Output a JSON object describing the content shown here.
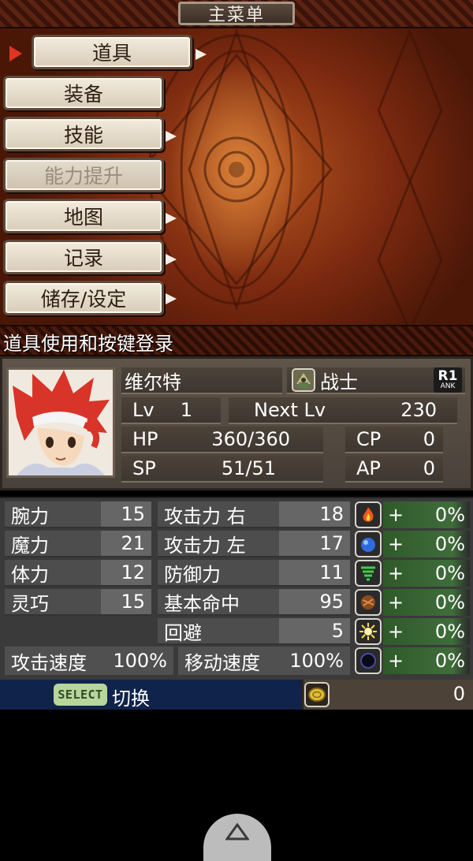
{
  "header": {
    "title": "主菜单"
  },
  "menu": {
    "items": [
      {
        "label": "道具",
        "selected": true,
        "disabled": false,
        "has_submenu": true
      },
      {
        "label": "装备",
        "selected": false,
        "disabled": false,
        "has_submenu": false
      },
      {
        "label": "技能",
        "selected": false,
        "disabled": false,
        "has_submenu": true
      },
      {
        "label": "能力提升",
        "selected": false,
        "disabled": true,
        "has_submenu": false
      },
      {
        "label": "地图",
        "selected": false,
        "disabled": false,
        "has_submenu": true
      },
      {
        "label": "记录",
        "selected": false,
        "disabled": false,
        "has_submenu": true
      },
      {
        "label": "储存/设定",
        "selected": false,
        "disabled": false,
        "has_submenu": true
      }
    ],
    "description": "道具使用和按键登录"
  },
  "character": {
    "name": "维尔特",
    "class": "战士",
    "class_icon": "warrior-icon",
    "rank_badge": {
      "top": "R1",
      "bottom": "ANK"
    },
    "lv_label": "Lv",
    "lv": "1",
    "next_lv_label": "Next Lv",
    "next_lv": "230",
    "hp_label": "HP",
    "hp": "360/360",
    "sp_label": "SP",
    "sp": "51/51",
    "cp_label": "CP",
    "cp": "0",
    "ap_label": "AP",
    "ap": "0"
  },
  "stats": {
    "left": [
      {
        "label": "腕力",
        "value": "15"
      },
      {
        "label": "魔力",
        "value": "21"
      },
      {
        "label": "体力",
        "value": "12"
      },
      {
        "label": "灵巧",
        "value": "15"
      }
    ],
    "middle": [
      {
        "label": "攻击力 右",
        "value": "18"
      },
      {
        "label": "攻击力 左",
        "value": "17"
      },
      {
        "label": "防御力",
        "value": "11"
      },
      {
        "label": "基本命中",
        "value": "95"
      },
      {
        "label": "回避",
        "value": "5"
      }
    ],
    "attack_speed_label": "攻击速度",
    "attack_speed": "100%",
    "move_speed_label": "移动速度",
    "move_speed": "100%"
  },
  "elements": [
    {
      "icon": "fire-icon",
      "sign": "+",
      "value": "0%"
    },
    {
      "icon": "water-icon",
      "sign": "+",
      "value": "0%"
    },
    {
      "icon": "wind-icon",
      "sign": "+",
      "value": "0%"
    },
    {
      "icon": "earth-icon",
      "sign": "+",
      "value": "0%"
    },
    {
      "icon": "light-icon",
      "sign": "+",
      "value": "0%"
    },
    {
      "icon": "dark-icon",
      "sign": "+",
      "value": "0%"
    }
  ],
  "footer": {
    "select_label": "SELECT",
    "switch_label": "切换",
    "money": "0"
  },
  "colors": {
    "accent_red": "#e23324",
    "menu_button": "#f2ebdd",
    "select_badge": "#b7d69a",
    "bottom_bar": "#10234a"
  }
}
